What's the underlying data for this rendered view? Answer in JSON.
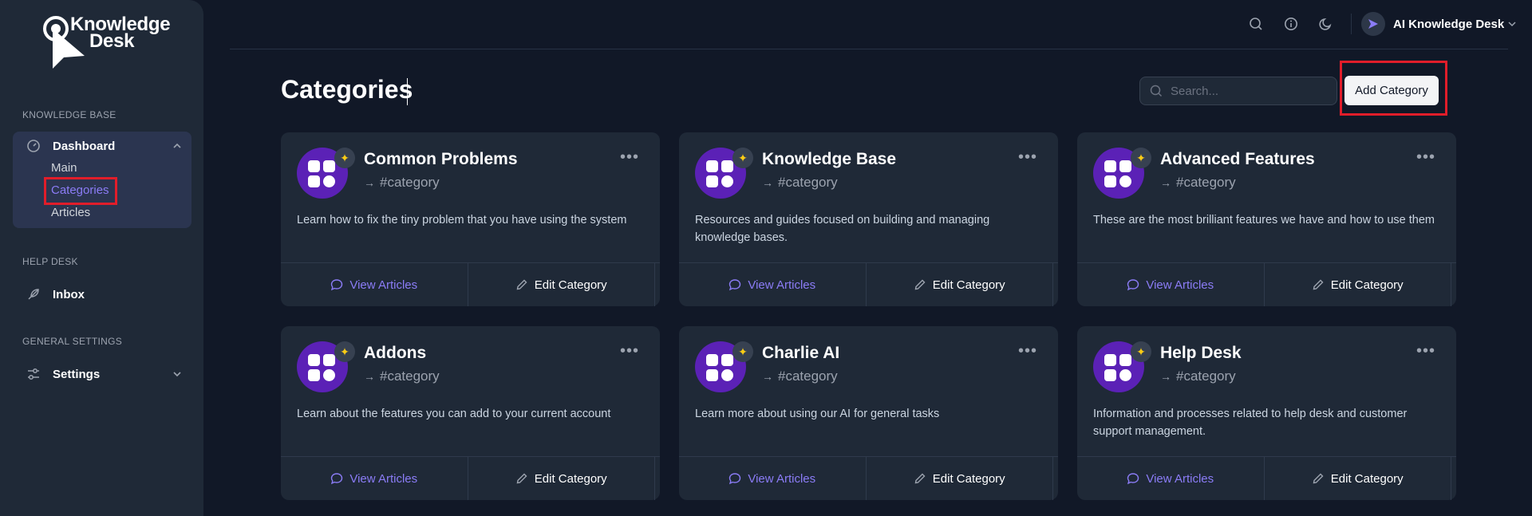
{
  "app": {
    "logo_line1": "Knowledge",
    "logo_line2": "Desk"
  },
  "sidebar": {
    "sections": {
      "knowledge_base": "KNOWLEDGE BASE",
      "help_desk": "HELP DESK",
      "general_settings": "GENERAL SETTINGS"
    },
    "dashboard": {
      "label": "Dashboard",
      "sub_items": [
        "Main",
        "Categories",
        "Articles"
      ],
      "active": "Categories"
    },
    "inbox": {
      "label": "Inbox"
    },
    "settings": {
      "label": "Settings"
    }
  },
  "topbar": {
    "icons": [
      "search-icon",
      "info-icon",
      "moon-icon"
    ],
    "account_name": "AI Knowledge Desk"
  },
  "page": {
    "title": "Categories",
    "search_placeholder": "Search...",
    "add_button": "Add Category"
  },
  "cards": [
    {
      "title": "Common Problems",
      "tag": "#category",
      "description": "Learn how to fix the tiny problem that you have using the system",
      "view_label": "View Articles",
      "edit_label": "Edit Category"
    },
    {
      "title": "Knowledge Base",
      "tag": "#category",
      "description": "Resources and guides focused on building and managing knowledge bases.",
      "view_label": "View Articles",
      "edit_label": "Edit Category"
    },
    {
      "title": "Advanced Features",
      "tag": "#category",
      "description": "These are the most brilliant features we have and how to use them",
      "view_label": "View Articles",
      "edit_label": "Edit Category"
    },
    {
      "title": "Addons",
      "tag": "#category",
      "description": "Learn about the features you can add to your current account",
      "view_label": "View Articles",
      "edit_label": "Edit Category"
    },
    {
      "title": "Charlie AI",
      "tag": "#category",
      "description": "Learn more about using our AI for general tasks",
      "view_label": "View Articles",
      "edit_label": "Edit Category"
    },
    {
      "title": "Help Desk",
      "tag": "#category",
      "description": "Information and processes related to help desk and customer support management.",
      "view_label": "View Articles",
      "edit_label": "Edit Category"
    }
  ],
  "colors": {
    "background": "#111827",
    "surface": "#1f2937",
    "accent": "#8b7cf6",
    "avatar": "#5b21b6",
    "highlight": "#e11d2a"
  }
}
